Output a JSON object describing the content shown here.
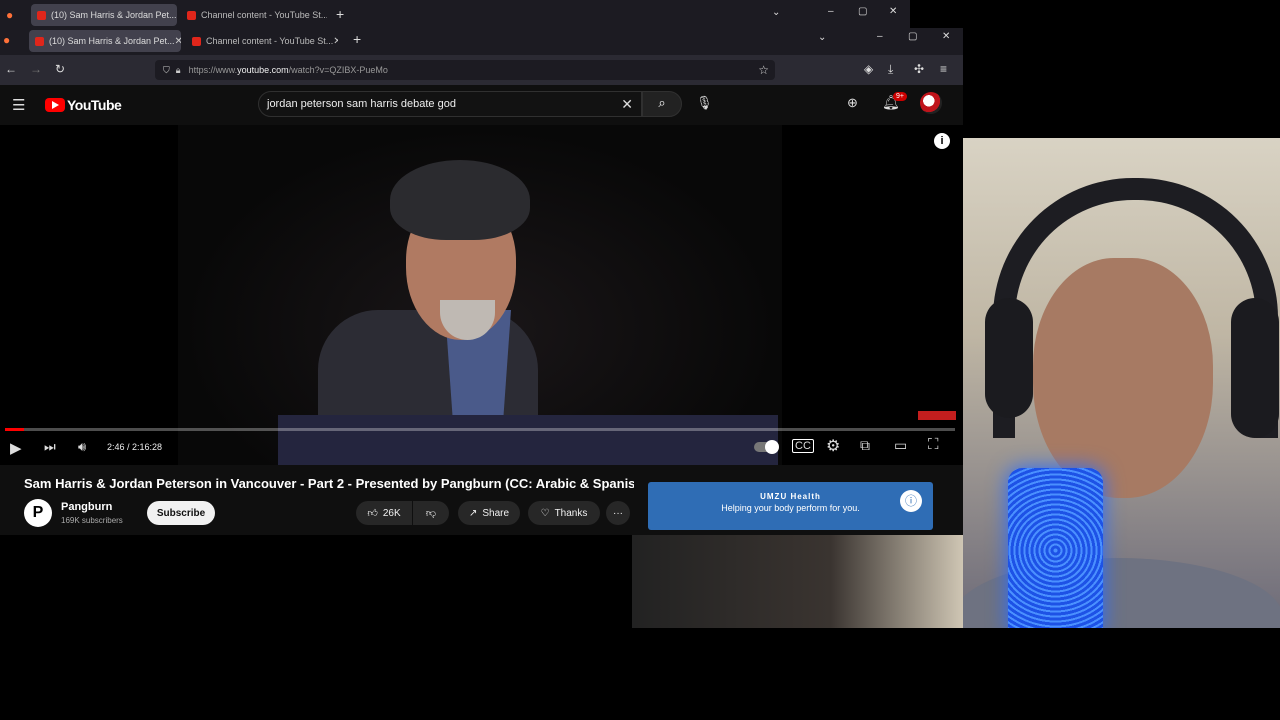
{
  "browser": {
    "tabs_row1": [
      {
        "label": "(10) Sam Harris & Jordan Pet...",
        "active": true
      },
      {
        "label": "Channel content - YouTube St...",
        "active": false
      }
    ],
    "tabs_row2": [
      {
        "label": "(10) Sam Harris & Jordan Pet...",
        "active": true
      },
      {
        "label": "Channel content - YouTube St...",
        "active": false
      }
    ],
    "new_tab": "+",
    "url_prefix": "https://www.",
    "url_domain": "youtube.com",
    "url_suffix": "/watch?v=QZIBX-PueMo"
  },
  "youtube": {
    "logo_text": "YouTube",
    "search_value": "jordan peterson sam harris debate god",
    "notification_badge": "9+",
    "player": {
      "time": "2:46 / 2:16:28",
      "progress_fraction": 0.02
    },
    "video_title": "Sam Harris & Jordan Peterson in Vancouver - Part 2 - Presented by Pangburn (CC: Arabic & Spanish)",
    "channel_name": "Pangburn",
    "subscribers": "169K subscribers",
    "subscribe_label": "Subscribe",
    "like_count": "26K",
    "share_label": "Share",
    "thanks_label": "Thanks",
    "ad": {
      "title": "UMZU Health",
      "subtitle": "Helping your body perform for you."
    }
  },
  "colors": {
    "youtube_red": "#ff0000",
    "ad_blue": "#2f6db5",
    "mic_blue": "#2a6cff"
  }
}
